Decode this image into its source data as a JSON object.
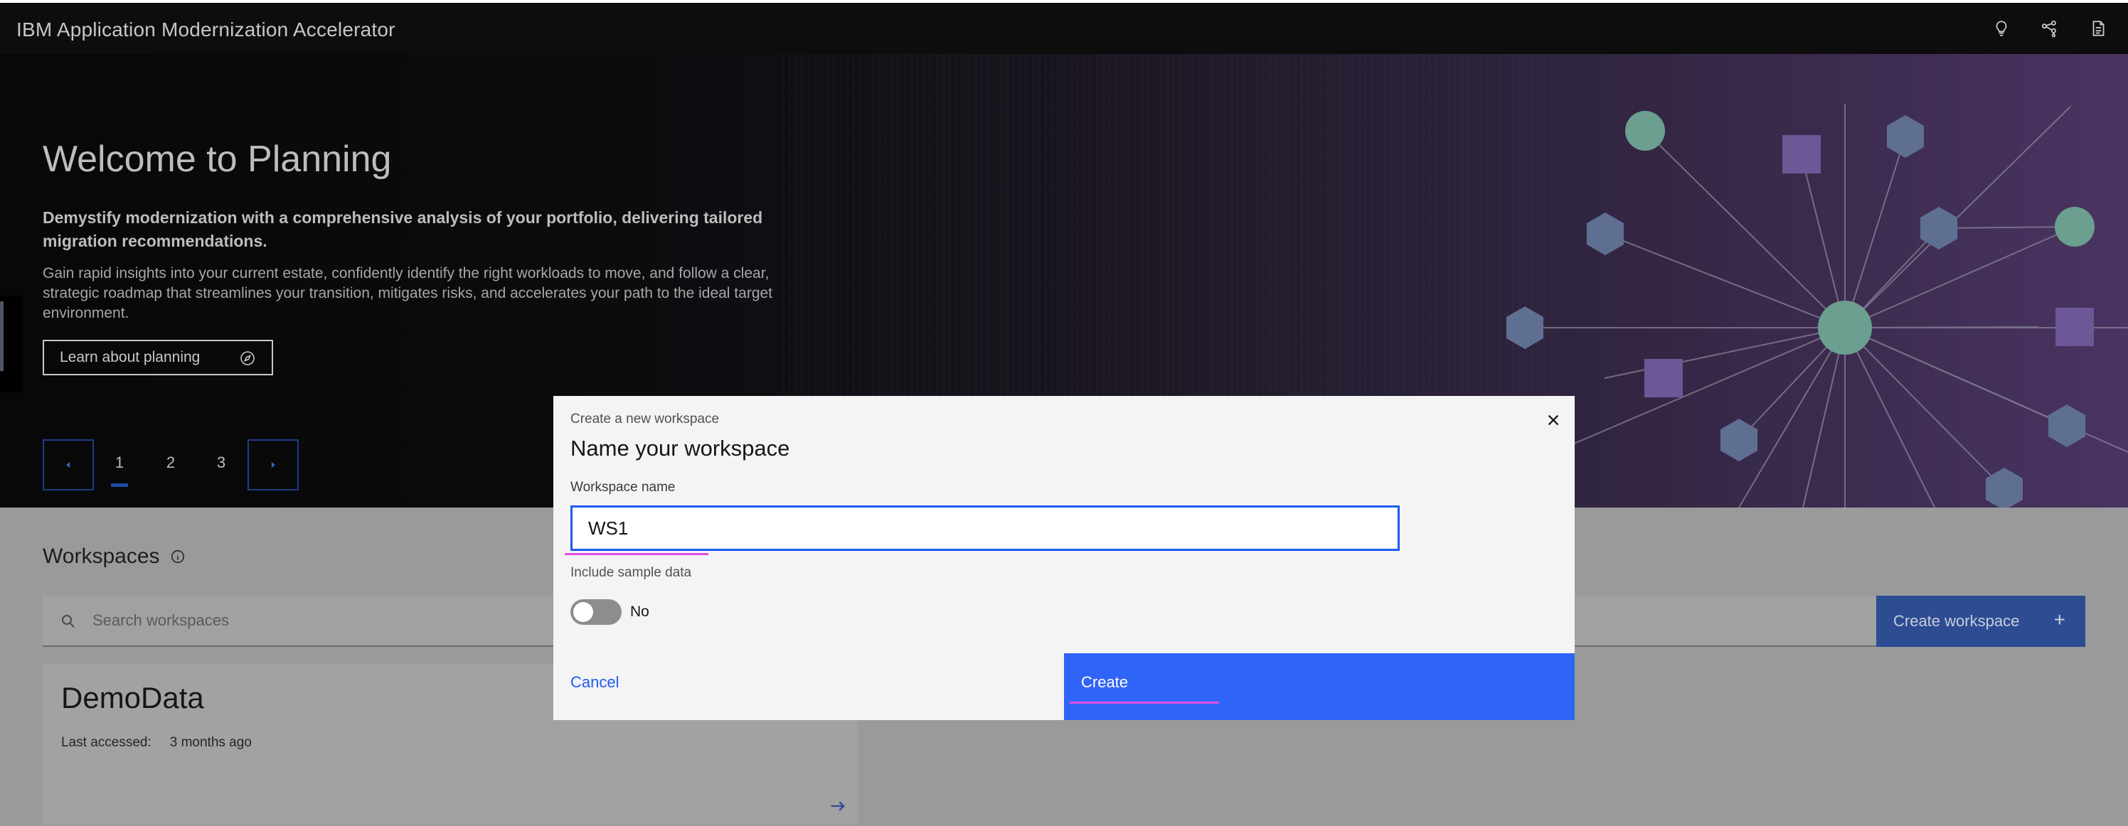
{
  "header": {
    "app_title": "IBM Application Modernization Accelerator",
    "icons": [
      "lightbulb-icon",
      "share-nodes-icon",
      "document-icon"
    ]
  },
  "hero": {
    "title": "Welcome to Planning",
    "subtitle": "Demystify modernization with a comprehensive analysis of your portfolio, delivering tailored migration recommendations.",
    "description": "Gain rapid insights into your current estate, confidently identify the right workloads to move, and follow a clear, strategic roadmap that streamlines your transition, mitigates risks, and accelerates your path to the ideal target environment.",
    "learn_button": "Learn about planning",
    "pager": {
      "pages": [
        "1",
        "2",
        "3"
      ],
      "active": "1"
    }
  },
  "workspaces": {
    "heading": "Workspaces",
    "search_placeholder": "Search workspaces",
    "create_button": "Create workspace",
    "card": {
      "name": "DemoData",
      "last_accessed_label": "Last accessed:",
      "last_accessed_value": "3 months ago"
    }
  },
  "modal": {
    "label": "Create a new workspace",
    "heading": "Name your workspace",
    "field_label": "Workspace name",
    "field_value": "WS1",
    "sample_label": "Include sample data",
    "toggle_text": "No",
    "cancel_label": "Cancel",
    "create_label": "Create"
  },
  "colors": {
    "primary_blue": "#2f64f6",
    "header_bg": "#0d0d0d",
    "hero_purple": "#4a3462",
    "node_green": "#6c9f8f",
    "node_hex": "#5f6f92",
    "node_square": "#6c5896"
  }
}
